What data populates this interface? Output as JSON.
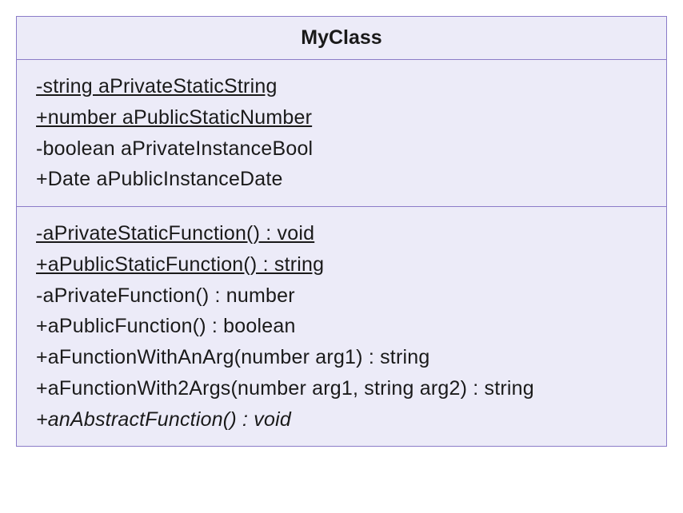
{
  "classBox": {
    "name": "MyClass",
    "attributes": [
      {
        "text": "-string aPrivateStaticString",
        "static": true,
        "abstract": false
      },
      {
        "text": "+number aPublicStaticNumber",
        "static": true,
        "abstract": false
      },
      {
        "text": "-boolean aPrivateInstanceBool",
        "static": false,
        "abstract": false
      },
      {
        "text": "+Date aPublicInstanceDate",
        "static": false,
        "abstract": false
      }
    ],
    "methods": [
      {
        "text": "-aPrivateStaticFunction() : void",
        "static": true,
        "abstract": false
      },
      {
        "text": "+aPublicStaticFunction() : string",
        "static": true,
        "abstract": false
      },
      {
        "text": "-aPrivateFunction() : number",
        "static": false,
        "abstract": false
      },
      {
        "text": "+aPublicFunction() : boolean",
        "static": false,
        "abstract": false
      },
      {
        "text": "+aFunctionWithAnArg(number arg1) : string",
        "static": false,
        "abstract": false
      },
      {
        "text": "+aFunctionWith2Args(number arg1, string arg2) : string",
        "static": false,
        "abstract": false
      },
      {
        "text": "+anAbstractFunction() : void",
        "static": false,
        "abstract": true
      }
    ]
  }
}
